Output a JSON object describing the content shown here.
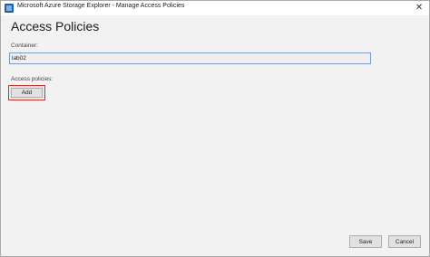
{
  "window": {
    "title": "Microsoft Azure Storage Explorer - Manage Access Policies",
    "app_icon": "azure-storage-explorer-icon",
    "close_glyph": "✕"
  },
  "page": {
    "title": "Access Policies"
  },
  "container": {
    "label": "Container:",
    "value": "lab02"
  },
  "access_policies": {
    "label": "Access policies:",
    "add_label": "Add"
  },
  "footer": {
    "save_label": "Save",
    "cancel_label": "Cancel"
  },
  "colors": {
    "highlight": "#d0312d",
    "input_border": "#7a9cc6",
    "background": "#f2f2f2"
  }
}
